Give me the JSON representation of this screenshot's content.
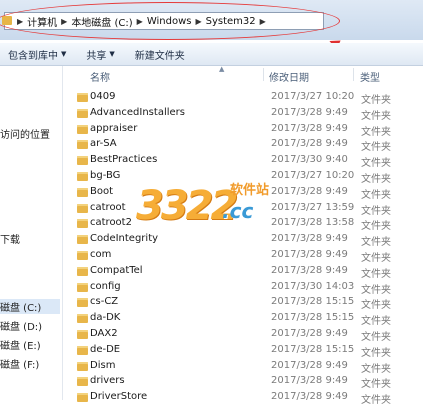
{
  "breadcrumb": {
    "items": [
      "计算机",
      "本地磁盘 (C:)",
      "Windows",
      "System32"
    ]
  },
  "toolbar": {
    "include_label": "包含到库中",
    "share_label": "共享",
    "new_folder_label": "新建文件夹"
  },
  "nav": {
    "recent_places": "访问的位置",
    "downloads": "下载",
    "drives": [
      {
        "label": "磁盘 (C:)",
        "selected": true
      },
      {
        "label": "磁盘 (D:)",
        "selected": false
      },
      {
        "label": "磁盘 (E:)",
        "selected": false
      },
      {
        "label": "磁盘 (F:)",
        "selected": false
      }
    ]
  },
  "columns": {
    "name": "名称",
    "modified": "修改日期",
    "type": "类型"
  },
  "files": [
    {
      "name": "0409",
      "date": "2017/3/27 10:20",
      "type": "文件夹"
    },
    {
      "name": "AdvancedInstallers",
      "date": "2017/3/28 9:49",
      "type": "文件夹"
    },
    {
      "name": "appraiser",
      "date": "2017/3/28 9:49",
      "type": "文件夹"
    },
    {
      "name": "ar-SA",
      "date": "2017/3/28 9:49",
      "type": "文件夹"
    },
    {
      "name": "BestPractices",
      "date": "2017/3/30 9:40",
      "type": "文件夹"
    },
    {
      "name": "bg-BG",
      "date": "2017/3/27 10:20",
      "type": "文件夹"
    },
    {
      "name": "Boot",
      "date": "2017/3/28 9:49",
      "type": "文件夹"
    },
    {
      "name": "catroot",
      "date": "2017/3/27 13:59",
      "type": "文件夹"
    },
    {
      "name": "catroot2",
      "date": "2017/3/28 13:58",
      "type": "文件夹"
    },
    {
      "name": "CodeIntegrity",
      "date": "2017/3/28 9:49",
      "type": "文件夹"
    },
    {
      "name": "com",
      "date": "2017/3/28 9:49",
      "type": "文件夹"
    },
    {
      "name": "CompatTel",
      "date": "2017/3/28 9:49",
      "type": "文件夹"
    },
    {
      "name": "config",
      "date": "2017/3/30 14:03",
      "type": "文件夹"
    },
    {
      "name": "cs-CZ",
      "date": "2017/3/28 15:15",
      "type": "文件夹"
    },
    {
      "name": "da-DK",
      "date": "2017/3/28 15:15",
      "type": "文件夹"
    },
    {
      "name": "DAX2",
      "date": "2017/3/28 9:49",
      "type": "文件夹"
    },
    {
      "name": "de-DE",
      "date": "2017/3/28 15:15",
      "type": "文件夹"
    },
    {
      "name": "Dism",
      "date": "2017/3/28 9:49",
      "type": "文件夹"
    },
    {
      "name": "drivers",
      "date": "2017/3/28 9:49",
      "type": "文件夹"
    },
    {
      "name": "DriverStore",
      "date": "2017/3/28 9:49",
      "type": "文件夹"
    }
  ],
  "watermark": {
    "number": "3322",
    "cc": ".cc",
    "site": "软件站"
  },
  "colors": {
    "annotation": "#e53a3a",
    "folder": "#e8b64a",
    "watermark_orange": "#f6ad37",
    "watermark_blue": "#3a9ad6"
  }
}
